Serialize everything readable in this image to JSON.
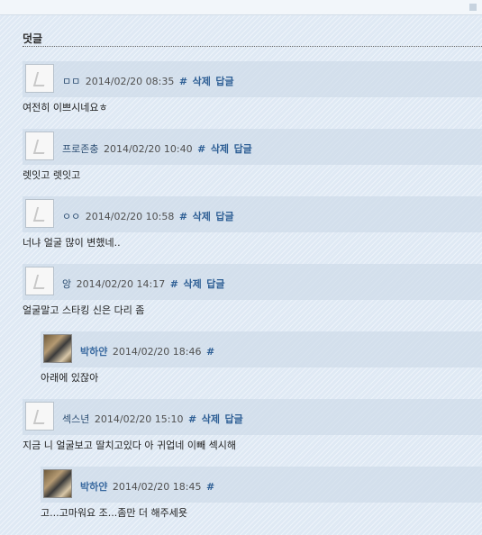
{
  "section": {
    "title": "덧글"
  },
  "actions": {
    "permalink": "#",
    "delete": "삭제",
    "reply": "답글"
  },
  "comments": [
    {
      "author": "ㅁㅁ",
      "date": "2014/02/20 08:35",
      "text": "여전히 이쁘시네요ㅎ",
      "is_reply": false,
      "avatar": "default-avatar"
    },
    {
      "author": "프로존충",
      "date": "2014/02/20 10:40",
      "text": "렛잇고 렛잇고",
      "is_reply": false,
      "avatar": "default-avatar"
    },
    {
      "author": "ㅇㅇ",
      "date": "2014/02/20 10:58",
      "text": "너냐 얼굴 많이 변했네..",
      "is_reply": false,
      "avatar": "default-avatar"
    },
    {
      "author": "앙",
      "date": "2014/02/20 14:17",
      "text": "얼굴말고 스타킹 신은 다리 좀",
      "is_reply": false,
      "avatar": "default-avatar"
    },
    {
      "author": "박하얀",
      "date": "2014/02/20 18:46",
      "text": "아래에 있잖아",
      "is_reply": true,
      "avatar": "photo-avatar"
    },
    {
      "author": "섹스년",
      "date": "2014/02/20 15:10",
      "text": "지금 니 얼굴보고 딸치고있다 아 귀업네 이빼 섹시해",
      "is_reply": false,
      "avatar": "default-avatar"
    },
    {
      "author": "박하얀",
      "date": "2014/02/20 18:45",
      "text": "고...고마워요 조...좀만 더 해주세욧",
      "is_reply": true,
      "avatar": "photo-avatar"
    }
  ]
}
